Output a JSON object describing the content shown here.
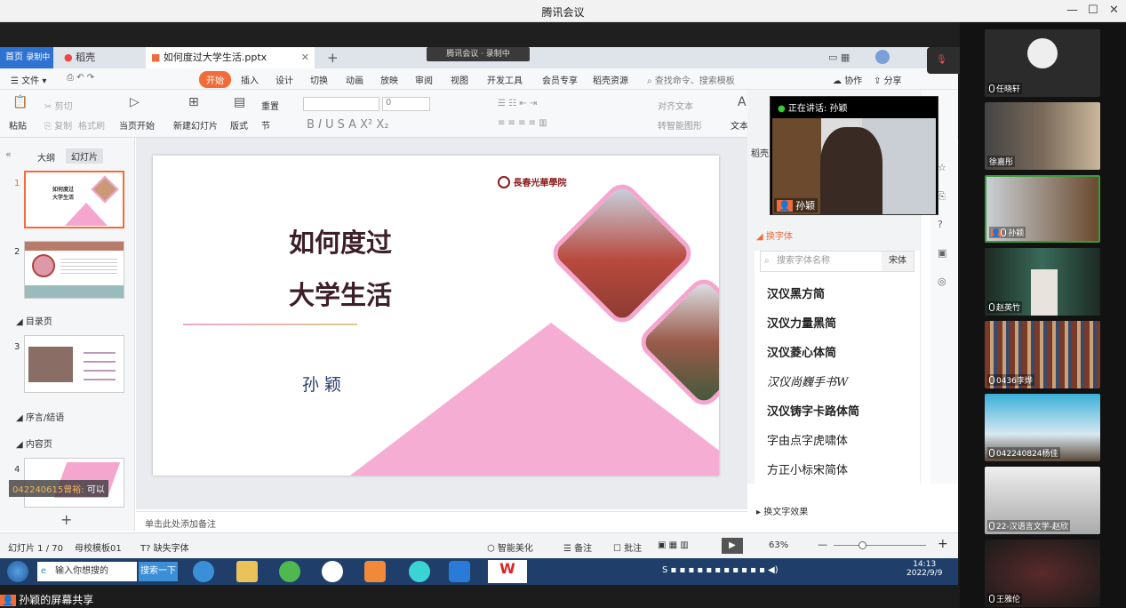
{
  "app": {
    "title": "腾讯会议"
  },
  "meeting": {
    "pill": "腾讯会议 · 录制中",
    "speaking": "正在讲话: 孙颖",
    "share_label": "孙颖的屏幕共享",
    "float_cam_name": "孙颖",
    "chat_sender": "042240615曾裕:",
    "chat_text": "可以"
  },
  "wps": {
    "tabs": {
      "home": "首页",
      "doc_tab": "稻壳",
      "ppt_tab": "如何度过大学生活.pptx",
      "recording": "录制中"
    },
    "menu": {
      "file": "文件",
      "start": "开始",
      "insert": "插入",
      "design": "设计",
      "switch": "切换",
      "animate": "动画",
      "play": "放映",
      "review": "审阅",
      "view": "视图",
      "dev": "开发工具",
      "vip": "会员专享",
      "docer": "稻壳资源",
      "search": "查找命令、搜索模板",
      "collab": "协作",
      "share": "分享"
    },
    "ribbon": {
      "paste": "粘贴",
      "cut": "剪切",
      "copy": "复制",
      "format": "格式刷",
      "from_current": "当页开始",
      "new_slide": "新建幻灯片",
      "layout": "版式",
      "reset": "重置",
      "section": "节",
      "textbox": "文本框",
      "font_size": "0",
      "align_text": "对齐文本",
      "smart_shape": "转智能图形"
    },
    "left": {
      "outline": "大纲",
      "slides": "幻灯片",
      "sec_toc": "目录页",
      "sec_intro": "序言/结语",
      "sec_content": "内容页"
    },
    "slide": {
      "title1": "如何度过",
      "title2": "大学生活",
      "author": "孙 颖",
      "school": "長春光華學院"
    },
    "notes": "单击此处添加备注",
    "right": {
      "docer": "稻壳",
      "font_swap": "换字体",
      "search_ph": "搜索字体名称",
      "current_font": "宋体",
      "fonts": [
        "汉仪黑方简",
        "汉仪力量黑简",
        "汉仪菱心体简",
        "汉仪尚巍手书W",
        "汉仪铸字卡路体简",
        "字由点字虎啸体",
        "方正小标宋简体"
      ],
      "text_effect": "换文字效果"
    },
    "status": {
      "slide_pos": "幻灯片 1 / 70",
      "master": "母校模板01",
      "missing_font": "缺失字体",
      "beautify": "智能美化",
      "notes": "备注",
      "comment": "批注",
      "zoom": "63%"
    }
  },
  "taskbar": {
    "search_ph": "输入你想搜的",
    "search_btn": "搜索一下",
    "time": "14:13",
    "date": "2022/9/9"
  },
  "participants": [
    {
      "name": "任晓轩"
    },
    {
      "name": "徐嘉彤"
    },
    {
      "name": "孙颖"
    },
    {
      "name": "赵英竹"
    },
    {
      "name": "0436李烨"
    },
    {
      "name": "042240824杨佳"
    },
    {
      "name": "22-汉语言文学-赵欣"
    },
    {
      "name": "王雅伦"
    }
  ],
  "colors": {
    "accent": "#f26b3a",
    "pink": "#f4a6cf",
    "brand_blue": "#2e72d2"
  }
}
